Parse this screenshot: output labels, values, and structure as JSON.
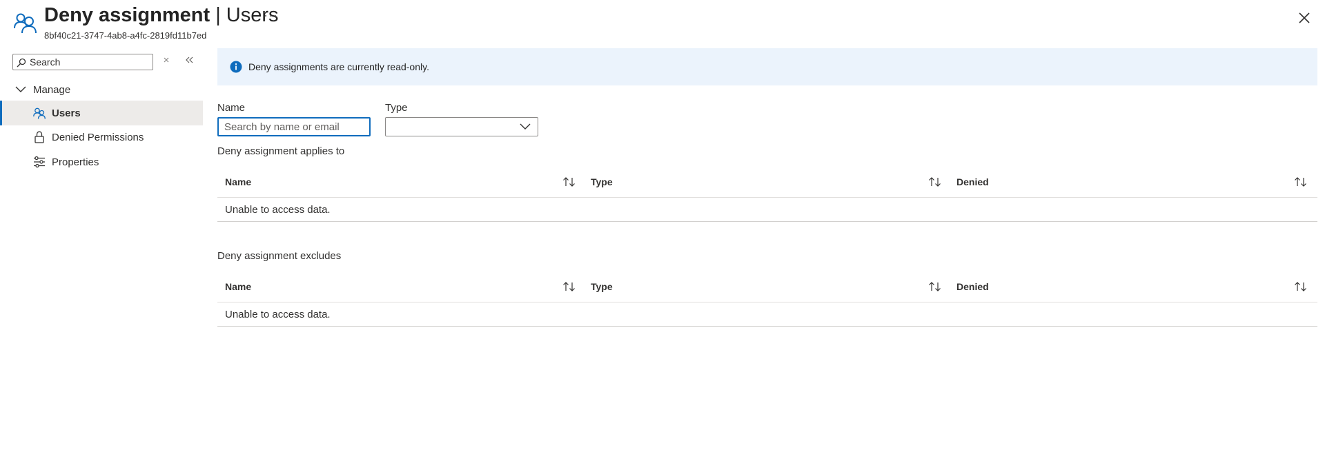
{
  "header": {
    "title_main": "Deny assignment",
    "title_sep": " | ",
    "title_section": "Users",
    "subtitle": "8bf40c21-3747-4ab8-a4fc-2819fd11b7ed",
    "more_label": "···",
    "icon": "users-icon"
  },
  "sidebar": {
    "search_placeholder": "Search",
    "group_label": "Manage",
    "items": [
      {
        "label": "Users",
        "icon": "users-icon",
        "active": true
      },
      {
        "label": "Denied Permissions",
        "icon": "lock-icon",
        "active": false
      },
      {
        "label": "Properties",
        "icon": "sliders-icon",
        "active": false
      }
    ]
  },
  "banner": {
    "text": "Deny assignments are currently read-only."
  },
  "filters": {
    "name_label": "Name",
    "name_placeholder": "Search by name or email",
    "type_label": "Type",
    "type_value": ""
  },
  "sections": [
    {
      "title": "Deny assignment applies to",
      "columns": [
        "Name",
        "Type",
        "Denied"
      ],
      "empty_text": "Unable to access data."
    },
    {
      "title": "Deny assignment excludes",
      "columns": [
        "Name",
        "Type",
        "Denied"
      ],
      "empty_text": "Unable to access data."
    }
  ],
  "colors": {
    "accent": "#0f6cbd",
    "banner_bg": "#ebf3fc",
    "active_nav_bg": "#edebe9"
  }
}
